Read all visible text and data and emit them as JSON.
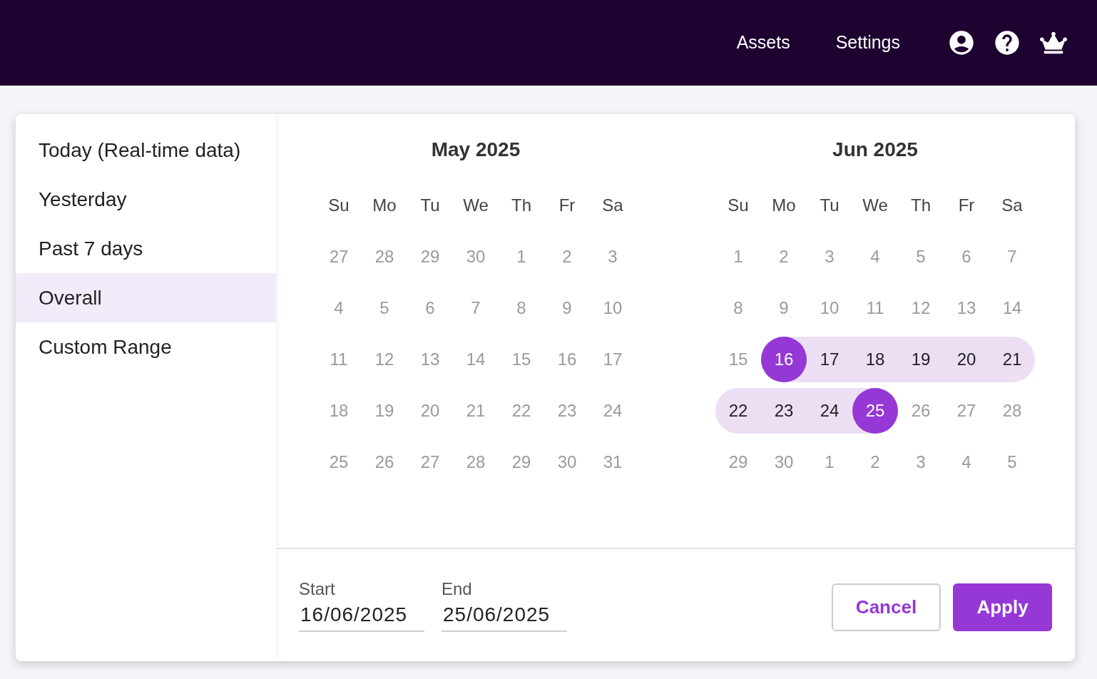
{
  "navbar": {
    "links": [
      "Assets",
      "Settings"
    ]
  },
  "presets": [
    {
      "label": "Today (Real-time data)",
      "selected": false
    },
    {
      "label": "Yesterday",
      "selected": false
    },
    {
      "label": "Past 7 days",
      "selected": false
    },
    {
      "label": "Overall",
      "selected": true
    },
    {
      "label": "Custom Range",
      "selected": false
    }
  ],
  "months": [
    {
      "title": "May 2025",
      "weekdays": [
        "Su",
        "Mo",
        "Tu",
        "We",
        "Th",
        "Fr",
        "Sa"
      ],
      "weeks": [
        [
          {
            "day": "27",
            "in_range": false,
            "selected": false
          },
          {
            "day": "28",
            "in_range": false,
            "selected": false
          },
          {
            "day": "29",
            "in_range": false,
            "selected": false
          },
          {
            "day": "30",
            "in_range": false,
            "selected": false
          },
          {
            "day": "1",
            "in_range": false,
            "selected": false
          },
          {
            "day": "2",
            "in_range": false,
            "selected": false
          },
          {
            "day": "3",
            "in_range": false,
            "selected": false
          }
        ],
        [
          {
            "day": "4",
            "in_range": false,
            "selected": false
          },
          {
            "day": "5",
            "in_range": false,
            "selected": false
          },
          {
            "day": "6",
            "in_range": false,
            "selected": false
          },
          {
            "day": "7",
            "in_range": false,
            "selected": false
          },
          {
            "day": "8",
            "in_range": false,
            "selected": false
          },
          {
            "day": "9",
            "in_range": false,
            "selected": false
          },
          {
            "day": "10",
            "in_range": false,
            "selected": false
          }
        ],
        [
          {
            "day": "11",
            "in_range": false,
            "selected": false
          },
          {
            "day": "12",
            "in_range": false,
            "selected": false
          },
          {
            "day": "13",
            "in_range": false,
            "selected": false
          },
          {
            "day": "14",
            "in_range": false,
            "selected": false
          },
          {
            "day": "15",
            "in_range": false,
            "selected": false
          },
          {
            "day": "16",
            "in_range": false,
            "selected": false
          },
          {
            "day": "17",
            "in_range": false,
            "selected": false
          }
        ],
        [
          {
            "day": "18",
            "in_range": false,
            "selected": false
          },
          {
            "day": "19",
            "in_range": false,
            "selected": false
          },
          {
            "day": "20",
            "in_range": false,
            "selected": false
          },
          {
            "day": "21",
            "in_range": false,
            "selected": false
          },
          {
            "day": "22",
            "in_range": false,
            "selected": false
          },
          {
            "day": "23",
            "in_range": false,
            "selected": false
          },
          {
            "day": "24",
            "in_range": false,
            "selected": false
          }
        ],
        [
          {
            "day": "25",
            "in_range": false,
            "selected": false
          },
          {
            "day": "26",
            "in_range": false,
            "selected": false
          },
          {
            "day": "27",
            "in_range": false,
            "selected": false
          },
          {
            "day": "28",
            "in_range": false,
            "selected": false
          },
          {
            "day": "29",
            "in_range": false,
            "selected": false
          },
          {
            "day": "30",
            "in_range": false,
            "selected": false
          },
          {
            "day": "31",
            "in_range": false,
            "selected": false
          }
        ]
      ]
    },
    {
      "title": "Jun 2025",
      "weekdays": [
        "Su",
        "Mo",
        "Tu",
        "We",
        "Th",
        "Fr",
        "Sa"
      ],
      "weeks": [
        [
          {
            "day": "1",
            "in_range": false,
            "selected": false
          },
          {
            "day": "2",
            "in_range": false,
            "selected": false
          },
          {
            "day": "3",
            "in_range": false,
            "selected": false
          },
          {
            "day": "4",
            "in_range": false,
            "selected": false
          },
          {
            "day": "5",
            "in_range": false,
            "selected": false
          },
          {
            "day": "6",
            "in_range": false,
            "selected": false
          },
          {
            "day": "7",
            "in_range": false,
            "selected": false
          }
        ],
        [
          {
            "day": "8",
            "in_range": false,
            "selected": false
          },
          {
            "day": "9",
            "in_range": false,
            "selected": false
          },
          {
            "day": "10",
            "in_range": false,
            "selected": false
          },
          {
            "day": "11",
            "in_range": false,
            "selected": false
          },
          {
            "day": "12",
            "in_range": false,
            "selected": false
          },
          {
            "day": "13",
            "in_range": false,
            "selected": false
          },
          {
            "day": "14",
            "in_range": false,
            "selected": false
          }
        ],
        [
          {
            "day": "15",
            "in_range": false,
            "selected": false
          },
          {
            "day": "16",
            "in_range": true,
            "selected": true
          },
          {
            "day": "17",
            "in_range": true,
            "selected": false
          },
          {
            "day": "18",
            "in_range": true,
            "selected": false
          },
          {
            "day": "19",
            "in_range": true,
            "selected": false
          },
          {
            "day": "20",
            "in_range": true,
            "selected": false
          },
          {
            "day": "21",
            "in_range": true,
            "selected": false
          }
        ],
        [
          {
            "day": "22",
            "in_range": true,
            "selected": false
          },
          {
            "day": "23",
            "in_range": true,
            "selected": false
          },
          {
            "day": "24",
            "in_range": true,
            "selected": false
          },
          {
            "day": "25",
            "in_range": true,
            "selected": true
          },
          {
            "day": "26",
            "in_range": false,
            "selected": false
          },
          {
            "day": "27",
            "in_range": false,
            "selected": false
          },
          {
            "day": "28",
            "in_range": false,
            "selected": false
          }
        ],
        [
          {
            "day": "29",
            "in_range": false,
            "selected": false
          },
          {
            "day": "30",
            "in_range": false,
            "selected": false
          },
          {
            "day": "1",
            "in_range": false,
            "selected": false
          },
          {
            "day": "2",
            "in_range": false,
            "selected": false
          },
          {
            "day": "3",
            "in_range": false,
            "selected": false
          },
          {
            "day": "4",
            "in_range": false,
            "selected": false
          },
          {
            "day": "5",
            "in_range": false,
            "selected": false
          }
        ]
      ]
    }
  ],
  "start": {
    "label": "Start",
    "value": "16/06/2025"
  },
  "end": {
    "label": "End",
    "value": "25/06/2025"
  },
  "buttons": {
    "cancel": "Cancel",
    "apply": "Apply"
  }
}
